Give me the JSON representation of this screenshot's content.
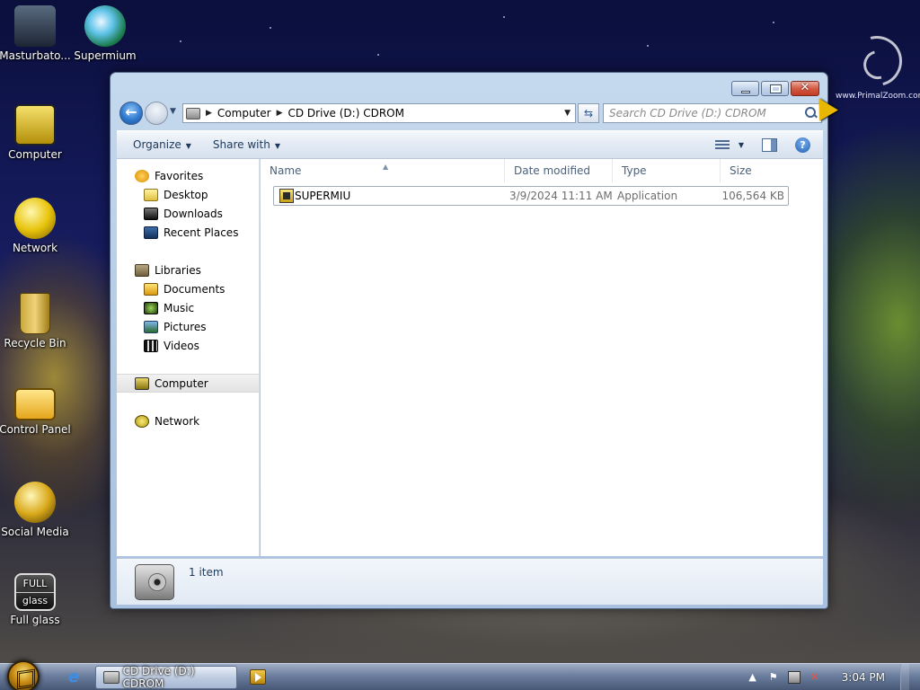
{
  "desktop": {
    "icons": [
      {
        "label": "Masturbato..."
      },
      {
        "label": "Supermium"
      },
      {
        "label": "Computer"
      },
      {
        "label": "Network"
      },
      {
        "label": "Recycle Bin"
      },
      {
        "label": "Control Panel"
      },
      {
        "label": "Social Media"
      },
      {
        "label": "Full glass"
      }
    ],
    "fullglass_badge_1": "FULL",
    "fullglass_badge_2": "glass",
    "watermark_text": "www.PrimalZoom.com"
  },
  "window": {
    "close_glyph": "✕",
    "address": {
      "segments": [
        "Computer",
        "CD Drive (D:) CDROM"
      ]
    },
    "search": {
      "placeholder": "Search CD Drive (D:) CDROM"
    },
    "toolbar": {
      "organize": "Organize",
      "share_with": "Share with"
    },
    "nav": {
      "favorites": "Favorites",
      "desktop": "Desktop",
      "downloads": "Downloads",
      "recent_places": "Recent Places",
      "libraries": "Libraries",
      "documents": "Documents",
      "music": "Music",
      "pictures": "Pictures",
      "videos": "Videos",
      "computer": "Computer",
      "network": "Network"
    },
    "columns": {
      "name": "Name",
      "date_modified": "Date modified",
      "type": "Type",
      "size": "Size"
    },
    "files": [
      {
        "name": "SUPERMIU",
        "date_modified": "3/9/2024 11:11 AM",
        "type": "Application",
        "size": "106,564 KB"
      }
    ],
    "details": {
      "item_count": "1 item"
    }
  },
  "taskbar": {
    "active_task": "CD Drive (D:) CDROM",
    "clock": "3:04 PM"
  },
  "colors": {
    "window_frame": "#b2c9e4",
    "close_button": "#c23b22",
    "link_text": "#1e395b"
  }
}
